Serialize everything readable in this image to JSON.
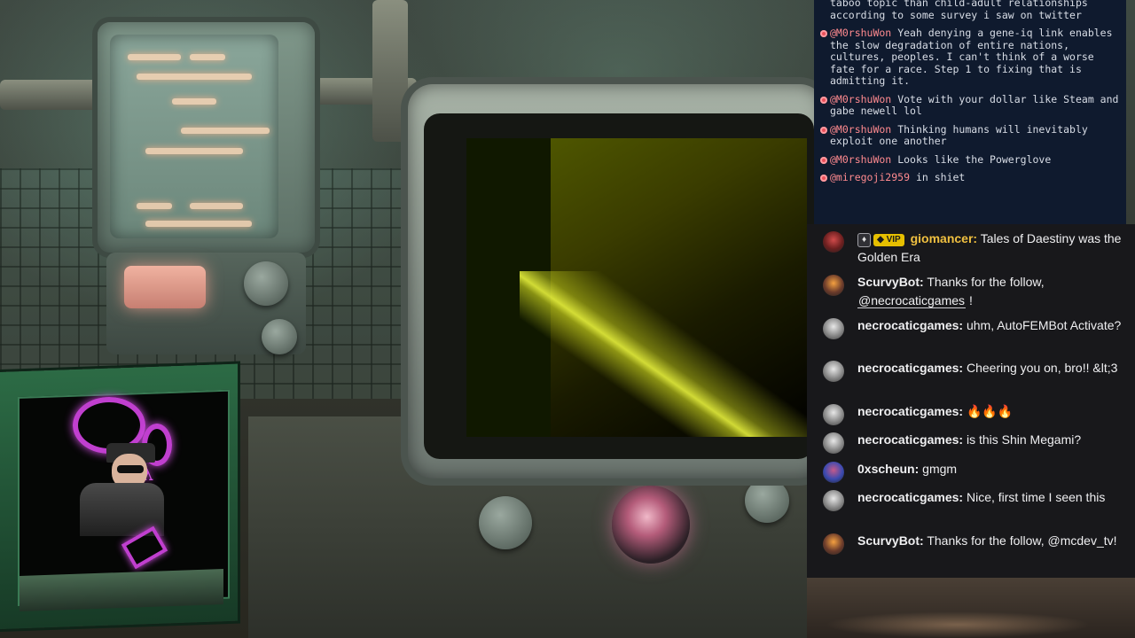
{
  "retro_chat": {
    "first_fragment": "taboo topic than child-adult relationships according to some survey i saw on twitter",
    "messages": [
      {
        "user": "@M0rshuWon",
        "text": "Yeah denying a gene-iq link enables the slow degradation of entire nations, cultures, peoples. I can't think of a worse fate for a race. Step 1 to fixing that is admitting it."
      },
      {
        "user": "@M0rshuWon",
        "text": "Vote with your dollar like Steam and gabe newell lol"
      },
      {
        "user": "@M0rshuWon",
        "text": "Thinking humans will inevitably exploit one another"
      },
      {
        "user": "@M0rshuWon",
        "text": "Looks like the Powerglove"
      },
      {
        "user": "@miregoji2959",
        "text": "in shiet"
      }
    ]
  },
  "chat": {
    "messages": [
      {
        "user": "giomancer",
        "user_color": "#f0c040",
        "badges": [
          "bits-badge",
          "VIP"
        ],
        "text": "Tales of Daestiny was the Golden Era"
      },
      {
        "user": "ScurvyBot",
        "user_color": "#efeff1",
        "text_before": "Thanks for the follow,",
        "mention": "@necrocaticgames",
        "text_after": "!"
      },
      {
        "user": "necrocaticgames",
        "user_color": "#efeff1",
        "text": "uhm, AutoFEMBot Activate?"
      },
      {
        "user": "necrocaticgames",
        "user_color": "#efeff1",
        "text": "Cheering you on, bro!! &lt;3"
      },
      {
        "user": "necrocaticgames",
        "user_color": "#efeff1",
        "text": "🔥🔥🔥"
      },
      {
        "user": "necrocaticgames",
        "user_color": "#efeff1",
        "text": "is this Shin Megami?"
      },
      {
        "user": "0xscheun",
        "user_color": "#efeff1",
        "text": "gmgm"
      },
      {
        "user": "necrocaticgames",
        "user_color": "#efeff1",
        "text": "Nice, first time I seen this"
      },
      {
        "user": "ScurvyBot",
        "user_color": "#efeff1",
        "text": "Thanks for the follow, @mcdev_tv!"
      }
    ]
  },
  "colors": {
    "retro_chat_bg": "#0f1a2e",
    "retro_user": "#ff8a8f",
    "chat_bg": "#18181b",
    "neon_accent": "#c03fcf"
  }
}
